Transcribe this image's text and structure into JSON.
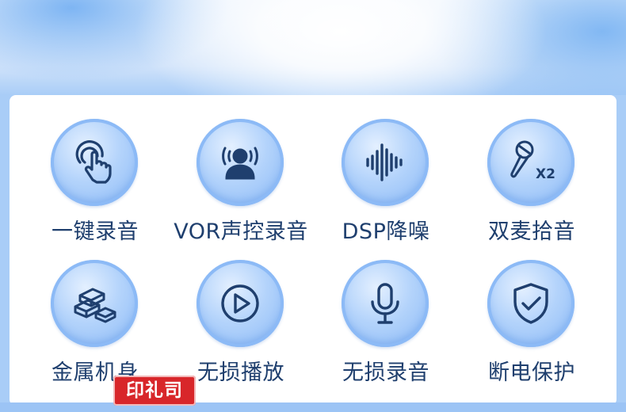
{
  "features": [
    {
      "id": "one-key-record",
      "label": "一键录音",
      "icon": "touch-tap-icon"
    },
    {
      "id": "vor-voice-record",
      "label": "VOR声控录音",
      "icon": "voice-person-icon"
    },
    {
      "id": "dsp-noise-reduction",
      "label": "DSP降噪",
      "icon": "sound-wave-icon"
    },
    {
      "id": "dual-mic",
      "label": "双麦拾音",
      "icon": "dual-mic-icon",
      "icon_text": "X2"
    },
    {
      "id": "metal-body",
      "label": "金属机身",
      "icon": "metal-bars-icon"
    },
    {
      "id": "lossless-playback",
      "label": "无损播放",
      "icon": "play-icon"
    },
    {
      "id": "lossless-record",
      "label": "无损录音",
      "icon": "microphone-icon"
    },
    {
      "id": "power-off-protect",
      "label": "断电保护",
      "icon": "shield-check-icon"
    }
  ],
  "watermark": {
    "text": "印礼司"
  },
  "colors": {
    "icon_stroke": "#1f3f6e",
    "label_text": "#1f3f6e",
    "panel": "#ffffff",
    "background": "#a9cdf7",
    "stamp": "#d8262a"
  }
}
